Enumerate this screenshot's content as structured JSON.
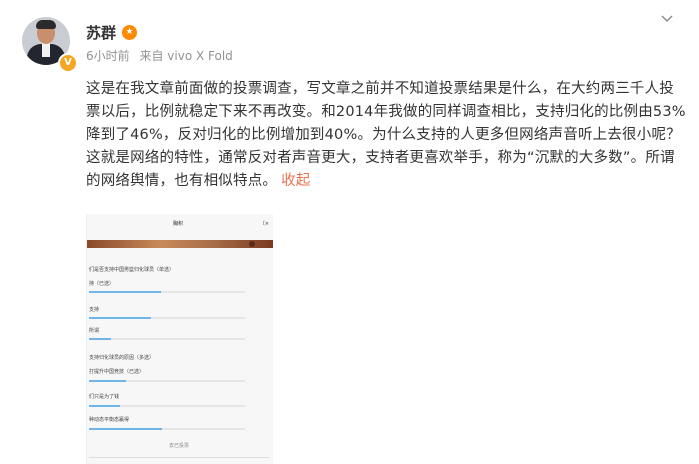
{
  "post": {
    "author": "苏群",
    "time": "6小时前",
    "source": "来自 vivo X Fold",
    "text_main": "这是在我文章前面做的投票调查，写文章之前并不知道投票结果是什么，在大约两三千人投票以后，比例就稳定下来不再改变。和2014年我做的同样调查相比，支持归化的比例由53%降到了46%，反对归化的比例增加到40%。为什么支持的人更多但网络声音听上去很小呢？这就是网络的特性，通常反对者声音更大，支持者更喜欢举手，称为“沉默的大多数”。所谓的网络舆情，也有相似特点。",
    "collapse_label": "收起",
    "verified_badge": "V"
  },
  "icons": {
    "avatar": "avatar",
    "verified": "verified-badge-icon",
    "name_badge": "gold-badge-icon",
    "chevron": "chevron-down-icon"
  },
  "colors": {
    "accent_link": "#eb7350",
    "meta_gray": "#939393",
    "vote_bar": "#6fb6e6"
  },
  "embedded_image": {
    "title": "胸积",
    "close": "〔×",
    "question1": "们是否支持中国男篮归化球员（单选）",
    "q1_options": [
      {
        "label": "持（已选）",
        "progress": 0.46
      },
      {
        "label": "支持",
        "progress": 0.4
      },
      {
        "label": "所谓",
        "progress": 0.14
      }
    ],
    "question2": "支持归化球员的原因（多选）",
    "q2_options": [
      {
        "label": "打提升中国竞技（已选）",
        "progress": 0.24
      },
      {
        "label": "们只是为了钱",
        "progress": 0.2
      },
      {
        "label": "种动态平衡态赢得",
        "progress": 0.47
      }
    ],
    "footer": "去已投票"
  }
}
